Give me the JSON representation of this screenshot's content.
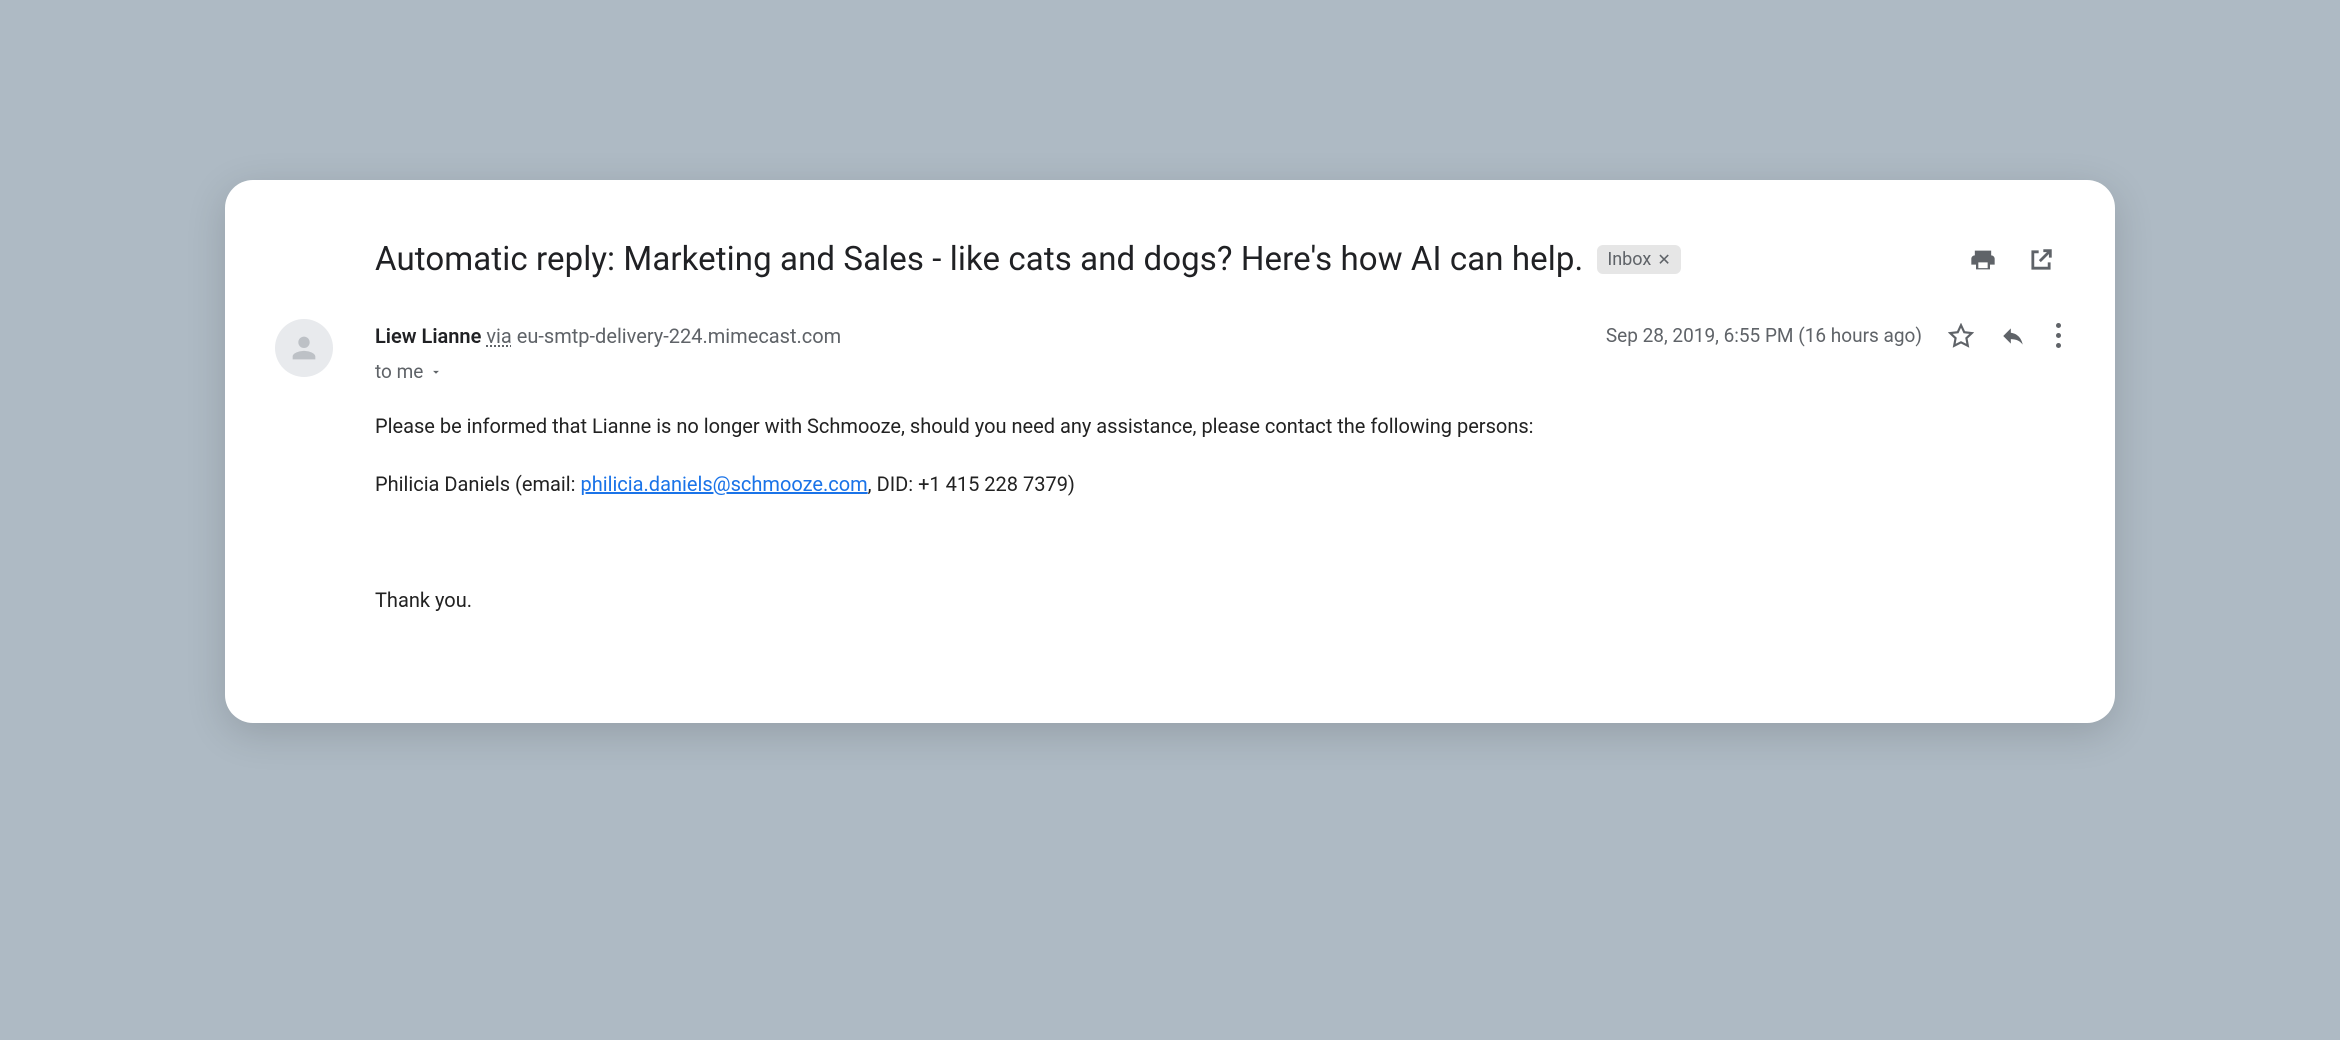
{
  "subject": "Automatic reply: Marketing and Sales - like cats and dogs? Here's how AI can help.",
  "label": "Inbox",
  "sender": {
    "name": "Liew Lianne",
    "via_word": "via",
    "via_host": "eu-smtp-delivery-224.mimecast.com"
  },
  "timestamp": "Sep 28, 2019, 6:55 PM (16 hours ago)",
  "to_line": "to me",
  "body": {
    "intro": "Please be informed that Lianne is no longer with Schmooze, should you need any assistance, please contact the following persons:",
    "contact_prefix": "Philicia Daniels (email: ",
    "contact_email": "philicia.daniels@schmooze.com",
    "contact_suffix": ", DID: +1 415 228 7379)",
    "signoff": "Thank you."
  }
}
